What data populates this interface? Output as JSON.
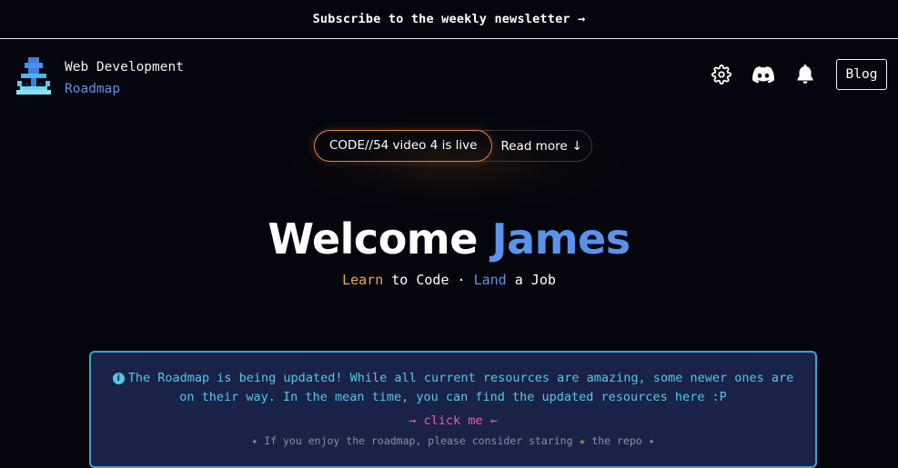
{
  "topbar": {
    "text": "Subscribe to the weekly newsletter →"
  },
  "header": {
    "brand_line1": "Web Development",
    "brand_line2": "Roadmap",
    "icons": [
      "gear-icon",
      "discord-icon",
      "bell-icon"
    ],
    "blog_label": "Blog"
  },
  "announcement": {
    "badge": "CODE//54 video 4 is live",
    "read_more": "Read more",
    "read_more_arrow": "↓"
  },
  "hero": {
    "welcome": "Welcome",
    "name": "James",
    "learn": "Learn",
    "to_code": " to Code · ",
    "land": "Land",
    "a_job": " a Job"
  },
  "notice": {
    "message": "The Roadmap is being updated! While all current resources are amazing, some newer ones are on their way. In the mean time, you can find the updated resources here :P",
    "link": "→ click me ←",
    "star_prefix": "✦ If you enjoy the roadmap, please consider staring ",
    "star_icon": "★",
    "star_suffix": " the repo ✦"
  },
  "colors": {
    "background": "#04050d",
    "accent_blue": "#5b93ea",
    "accent_orange": "#f0a941",
    "notice_bg": "#1a2248",
    "notice_border": "#3aa3d4",
    "notice_text": "#54c6e6",
    "link_pink": "#e45fb1"
  }
}
